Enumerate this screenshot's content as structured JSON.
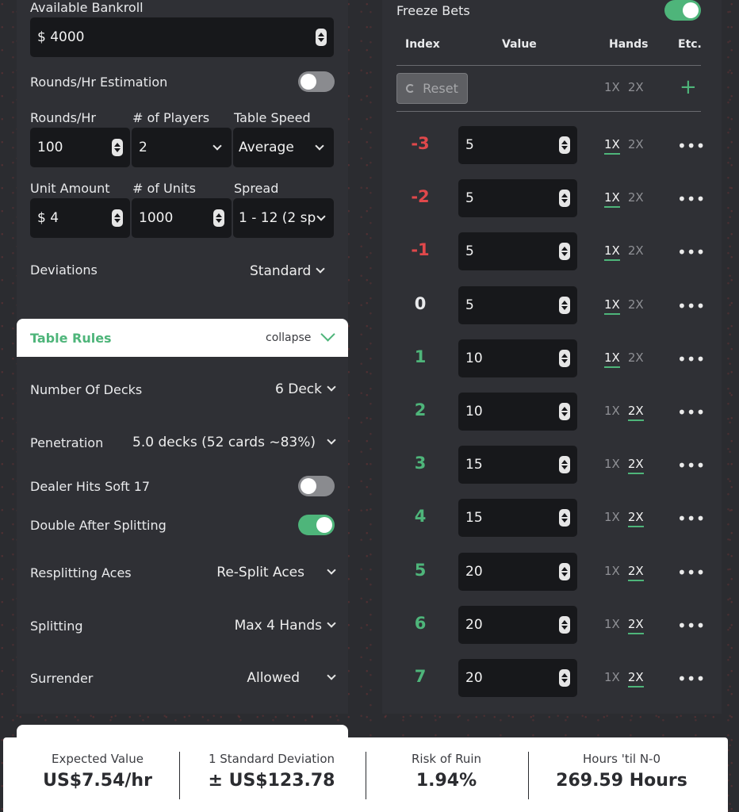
{
  "bankroll": {
    "label": "Available Bankroll",
    "value": "$ 4000"
  },
  "rounds_estimation": {
    "label": "Rounds/Hr Estimation",
    "enabled": false
  },
  "rounds_row": {
    "rounds_label": "Rounds/Hr",
    "rounds_value": "100",
    "players_label": "# of Players",
    "players_value": "2",
    "speed_label": "Table Speed",
    "speed_value": "Average"
  },
  "units_row": {
    "unit_label": "Unit Amount",
    "unit_value": "$ 4",
    "count_label": "# of Units",
    "count_value": "1000",
    "spread_label": "Spread",
    "spread_value": "1 - 12 (2 sp"
  },
  "deviations": {
    "label": "Deviations",
    "value": "Standard"
  },
  "table_rules": {
    "title": "Table Rules",
    "collapse_label": "collapse",
    "rules": [
      {
        "label": "Number Of Decks",
        "value": "6 Deck"
      },
      {
        "label": "Penetration",
        "value": "5.0 decks (52 cards ~83%)"
      },
      {
        "label": "Dealer Hits Soft 17",
        "toggle": false
      },
      {
        "label": "Double After Splitting",
        "toggle": true
      },
      {
        "label": "Resplitting Aces",
        "value": "Re-Split Aces"
      },
      {
        "label": "Splitting",
        "value": "Max 4 Hands"
      },
      {
        "label": "Surrender",
        "value": "Allowed"
      }
    ]
  },
  "freeze_bets": {
    "label": "Freeze Bets",
    "enabled": true
  },
  "bets_table": {
    "headers": {
      "index": "Index",
      "value": "Value",
      "hands": "Hands",
      "etc": "Etc."
    },
    "reset_label": "Reset",
    "one_x": "1X",
    "two_x": "2X",
    "add_symbol": "+",
    "more_symbol": "•••",
    "rows": [
      {
        "index": "-3",
        "value": "5",
        "hands": "1X"
      },
      {
        "index": "-2",
        "value": "5",
        "hands": "1X"
      },
      {
        "index": "-1",
        "value": "5",
        "hands": "1X"
      },
      {
        "index": "0",
        "value": "5",
        "hands": "1X"
      },
      {
        "index": "1",
        "value": "10",
        "hands": "1X"
      },
      {
        "index": "2",
        "value": "10",
        "hands": "2X"
      },
      {
        "index": "3",
        "value": "15",
        "hands": "2X"
      },
      {
        "index": "4",
        "value": "15",
        "hands": "2X"
      },
      {
        "index": "5",
        "value": "20",
        "hands": "2X"
      },
      {
        "index": "6",
        "value": "20",
        "hands": "2X"
      },
      {
        "index": "7",
        "value": "20",
        "hands": "2X"
      }
    ]
  },
  "stats": [
    {
      "label": "Expected Value",
      "value": "US$7.54/hr"
    },
    {
      "label": "1 Standard Deviation",
      "value": "± US$123.78"
    },
    {
      "label": "Risk of Ruin",
      "value": "1.94%"
    },
    {
      "label": "Hours 'til N-0",
      "value": "269.59 Hours"
    }
  ],
  "colors": {
    "negative": "#e0484b",
    "zero": "#e8e9eb",
    "positive": "#4eb57a",
    "accent": "#4eb57a"
  },
  "icons": [
    "spinner-icon",
    "chevron-down-icon",
    "reset-icon",
    "plus-icon",
    "more-icon"
  ]
}
